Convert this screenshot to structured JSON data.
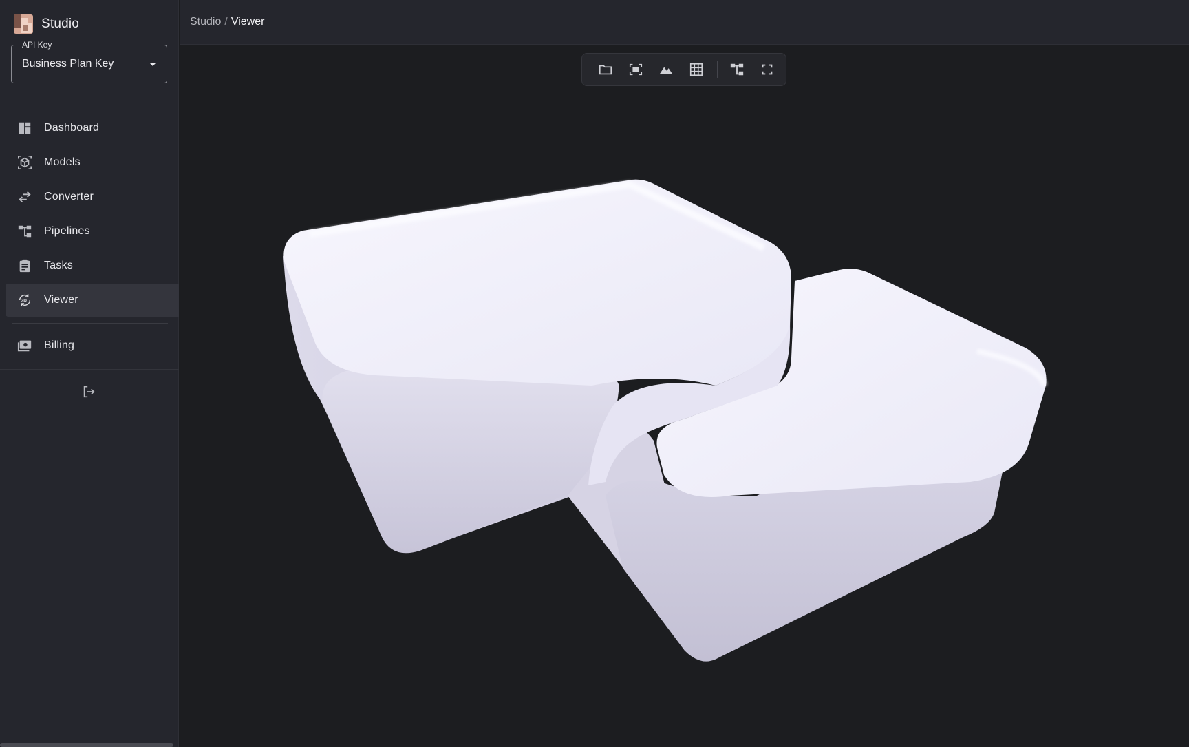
{
  "app": {
    "name": "Studio",
    "logo_icon": "studio-logo-icon"
  },
  "api_key": {
    "label": "API Key",
    "value": "Business Plan Key"
  },
  "nav": {
    "items": [
      {
        "label": "Dashboard",
        "icon": "dashboard-icon"
      },
      {
        "label": "Models",
        "icon": "cube-icon"
      },
      {
        "label": "Converter",
        "icon": "swap-arrows-icon"
      },
      {
        "label": "Pipelines",
        "icon": "pipeline-icon"
      },
      {
        "label": "Tasks",
        "icon": "clipboard-icon"
      },
      {
        "label": "Viewer",
        "icon": "3d-rotation-icon",
        "active": true
      }
    ],
    "billing": {
      "label": "Billing",
      "icon": "billing-icon"
    },
    "logout_icon": "logout-icon"
  },
  "breadcrumb": {
    "root": "Studio",
    "separator": "/",
    "current": "Viewer"
  },
  "toolbar": {
    "buttons": [
      "folder-open-icon",
      "fit-view-icon",
      "environment-icon",
      "grid-icon",
      "scene-tree-icon",
      "fullscreen-icon"
    ]
  },
  "colors": {
    "sidebar_bg": "#25262d",
    "viewport_bg": "#1c1d20",
    "active_item_bg": "#34353d",
    "logo_accent": "#c9a08f",
    "model_color": "#f1f0fb"
  }
}
